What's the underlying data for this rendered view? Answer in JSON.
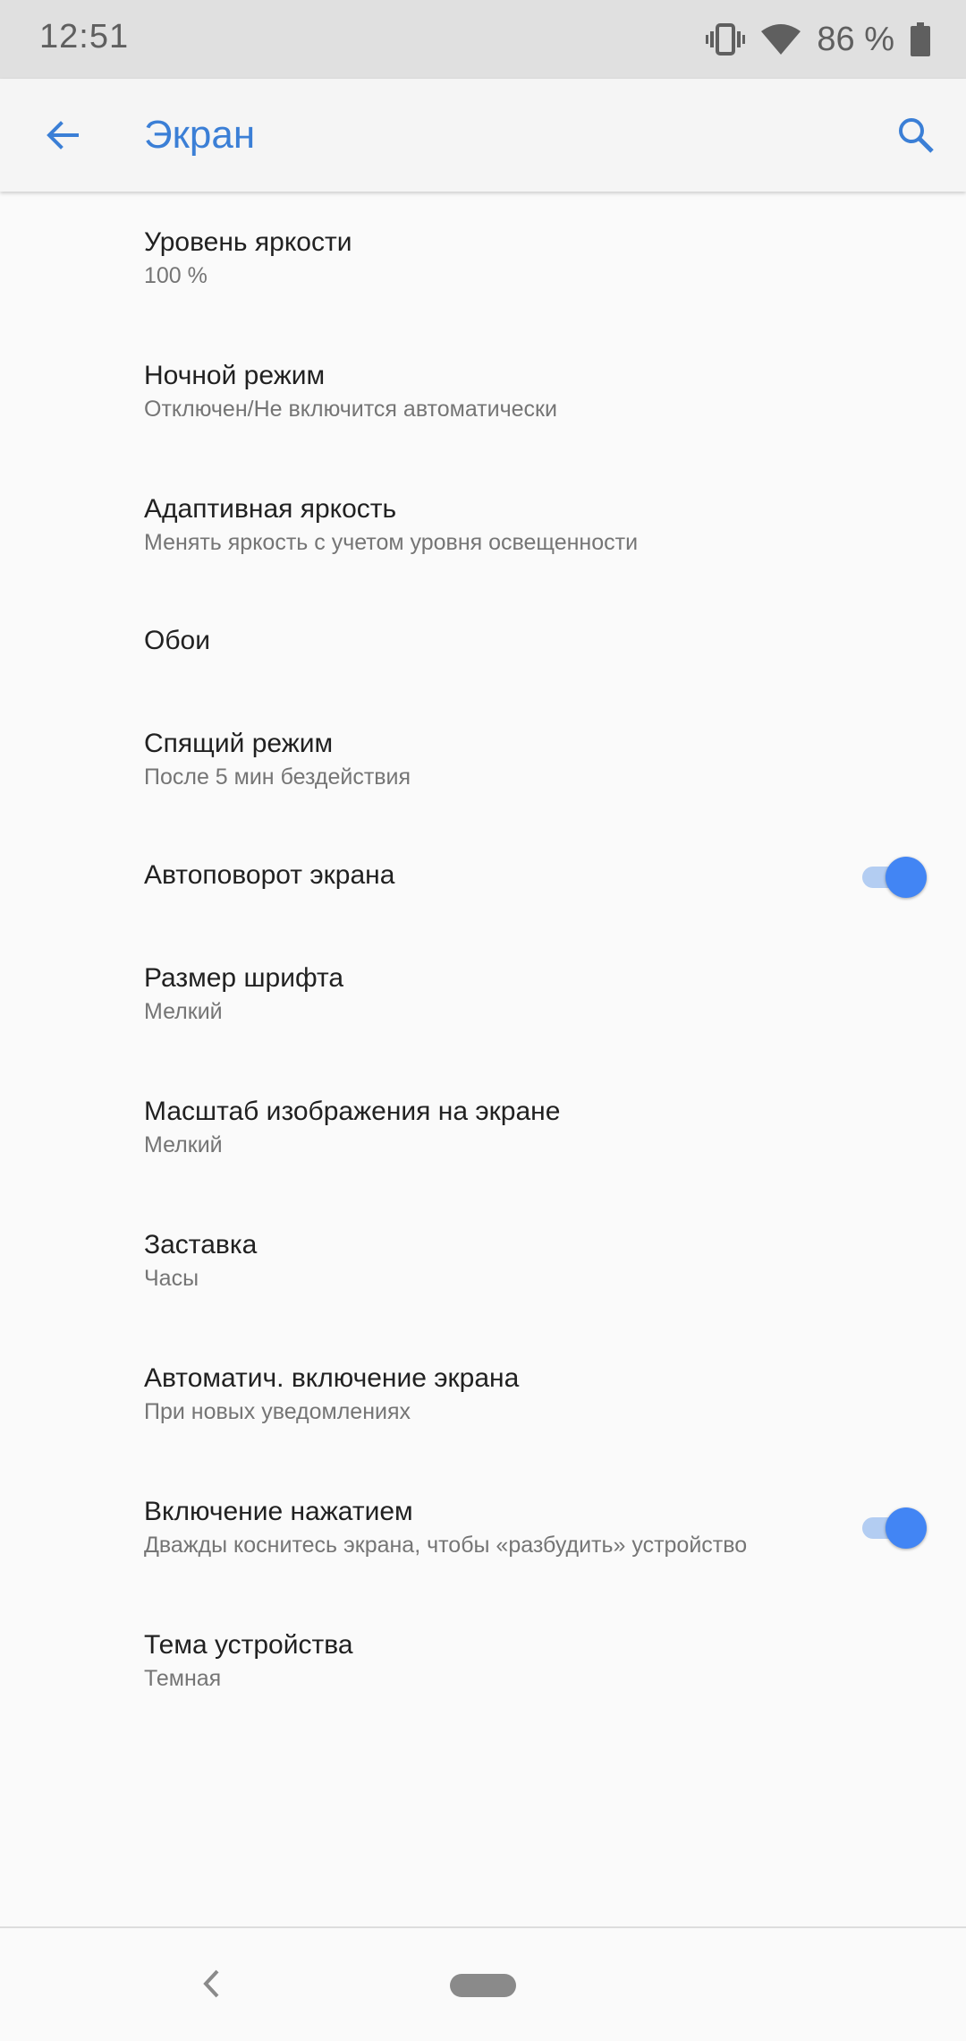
{
  "status": {
    "time": "12:51",
    "battery": "86 %",
    "icons": [
      "vibrate-icon",
      "wifi-icon",
      "battery-icon"
    ]
  },
  "appbar": {
    "title": "Экран",
    "icons": [
      "back-arrow-icon",
      "search-icon"
    ],
    "accent": "#3b7fd6"
  },
  "items": [
    {
      "title": "Уровень яркости",
      "summary": "100 %"
    },
    {
      "title": "Ночной режим",
      "summary": "Отключен/Не включится автоматически"
    },
    {
      "title": "Адаптивная яркость",
      "summary": "Менять яркость с учетом уровня освещенности"
    },
    {
      "title": "Обои"
    },
    {
      "title": "Спящий режим",
      "summary": "После 5 мин бездействия"
    },
    {
      "title": "Автоповорот экрана",
      "toggle": true
    },
    {
      "title": "Размер шрифта",
      "summary": "Мелкий"
    },
    {
      "title": "Масштаб изображения на экране",
      "summary": "Мелкий"
    },
    {
      "title": "Заставка",
      "summary": "Часы"
    },
    {
      "title": "Автоматич. включение экрана",
      "summary": "При новых уведомлениях"
    },
    {
      "title": "Включение нажатием",
      "summary": "Дважды коснитесь экрана, чтобы «разбудить» устройство",
      "toggle": true
    },
    {
      "title": "Тема устройства",
      "summary": "Темная"
    }
  ],
  "navbar": {
    "icons": [
      "nav-back-icon",
      "home-pill-icon"
    ]
  },
  "colors": {
    "switch_thumb": "#4285f4",
    "switch_track": "#b3cdf2",
    "background": "#fafafa"
  }
}
